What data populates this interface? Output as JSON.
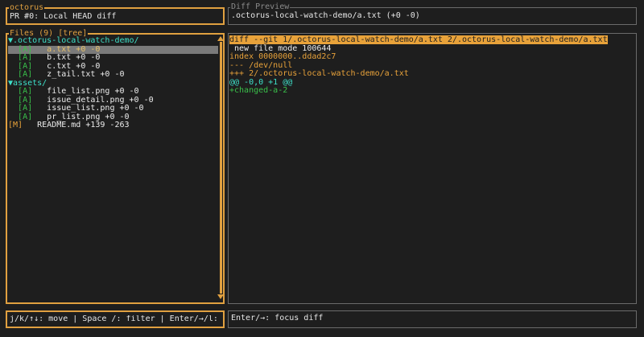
{
  "header": {
    "title": "octorus",
    "text": "PR #0: Local HEAD diff"
  },
  "diff_preview": {
    "title": "Diff Preview",
    "text": ".octorus-local-watch-demo/a.txt (+0 -0)"
  },
  "files": {
    "title": "Files (9) [tree]",
    "tree": [
      {
        "type": "dir",
        "prefix": "▼",
        "name": ".octorus-local-watch-demo/"
      },
      {
        "type": "file",
        "status": "[A]",
        "name": "a.txt +0 -0",
        "selected": true
      },
      {
        "type": "file",
        "status": "[A]",
        "name": "b.txt +0 -0"
      },
      {
        "type": "file",
        "status": "[A]",
        "name": "c.txt +0 -0"
      },
      {
        "type": "file",
        "status": "[A]",
        "name": "z_tail.txt +0 -0"
      },
      {
        "type": "dir",
        "prefix": "▼",
        "name": "assets/"
      },
      {
        "type": "file",
        "status": "[A]",
        "name": "file_list.png +0 -0"
      },
      {
        "type": "file",
        "status": "[A]",
        "name": "issue_detail.png +0 -0"
      },
      {
        "type": "file",
        "status": "[A]",
        "name": "issue_list.png +0 -0"
      },
      {
        "type": "file",
        "status": "[A]",
        "name": "pr_list.png +0 -0"
      },
      {
        "type": "file",
        "status": "[M]",
        "name": "README.md +139 -263",
        "root": true
      }
    ]
  },
  "diff": {
    "lines": [
      {
        "text": "diff --git 1/.octorus-local-watch-demo/a.txt 2/.octorus-local-watch-demo/a.txt",
        "style": "hl"
      },
      {
        "text": " new file mode 100644",
        "style": "white"
      },
      {
        "text": "index 0000000..ddad2c7",
        "style": "orange"
      },
      {
        "text": "--- /dev/null",
        "style": "orange"
      },
      {
        "text": "+++ 2/.octorus-local-watch-demo/a.txt",
        "style": "orange"
      },
      {
        "text": "@@ -0,0 +1 @@",
        "style": "cyan"
      },
      {
        "text": "+changed-a-2",
        "style": "green"
      }
    ]
  },
  "footer": {
    "left": "j/k/↑↓: move | Space /: filter | Enter/→/l: diff | O:",
    "right": "Enter/→: focus diff"
  },
  "colors": {
    "accent": "#e0a040",
    "added": "#39c04a",
    "hunk": "#3ee0c9"
  }
}
